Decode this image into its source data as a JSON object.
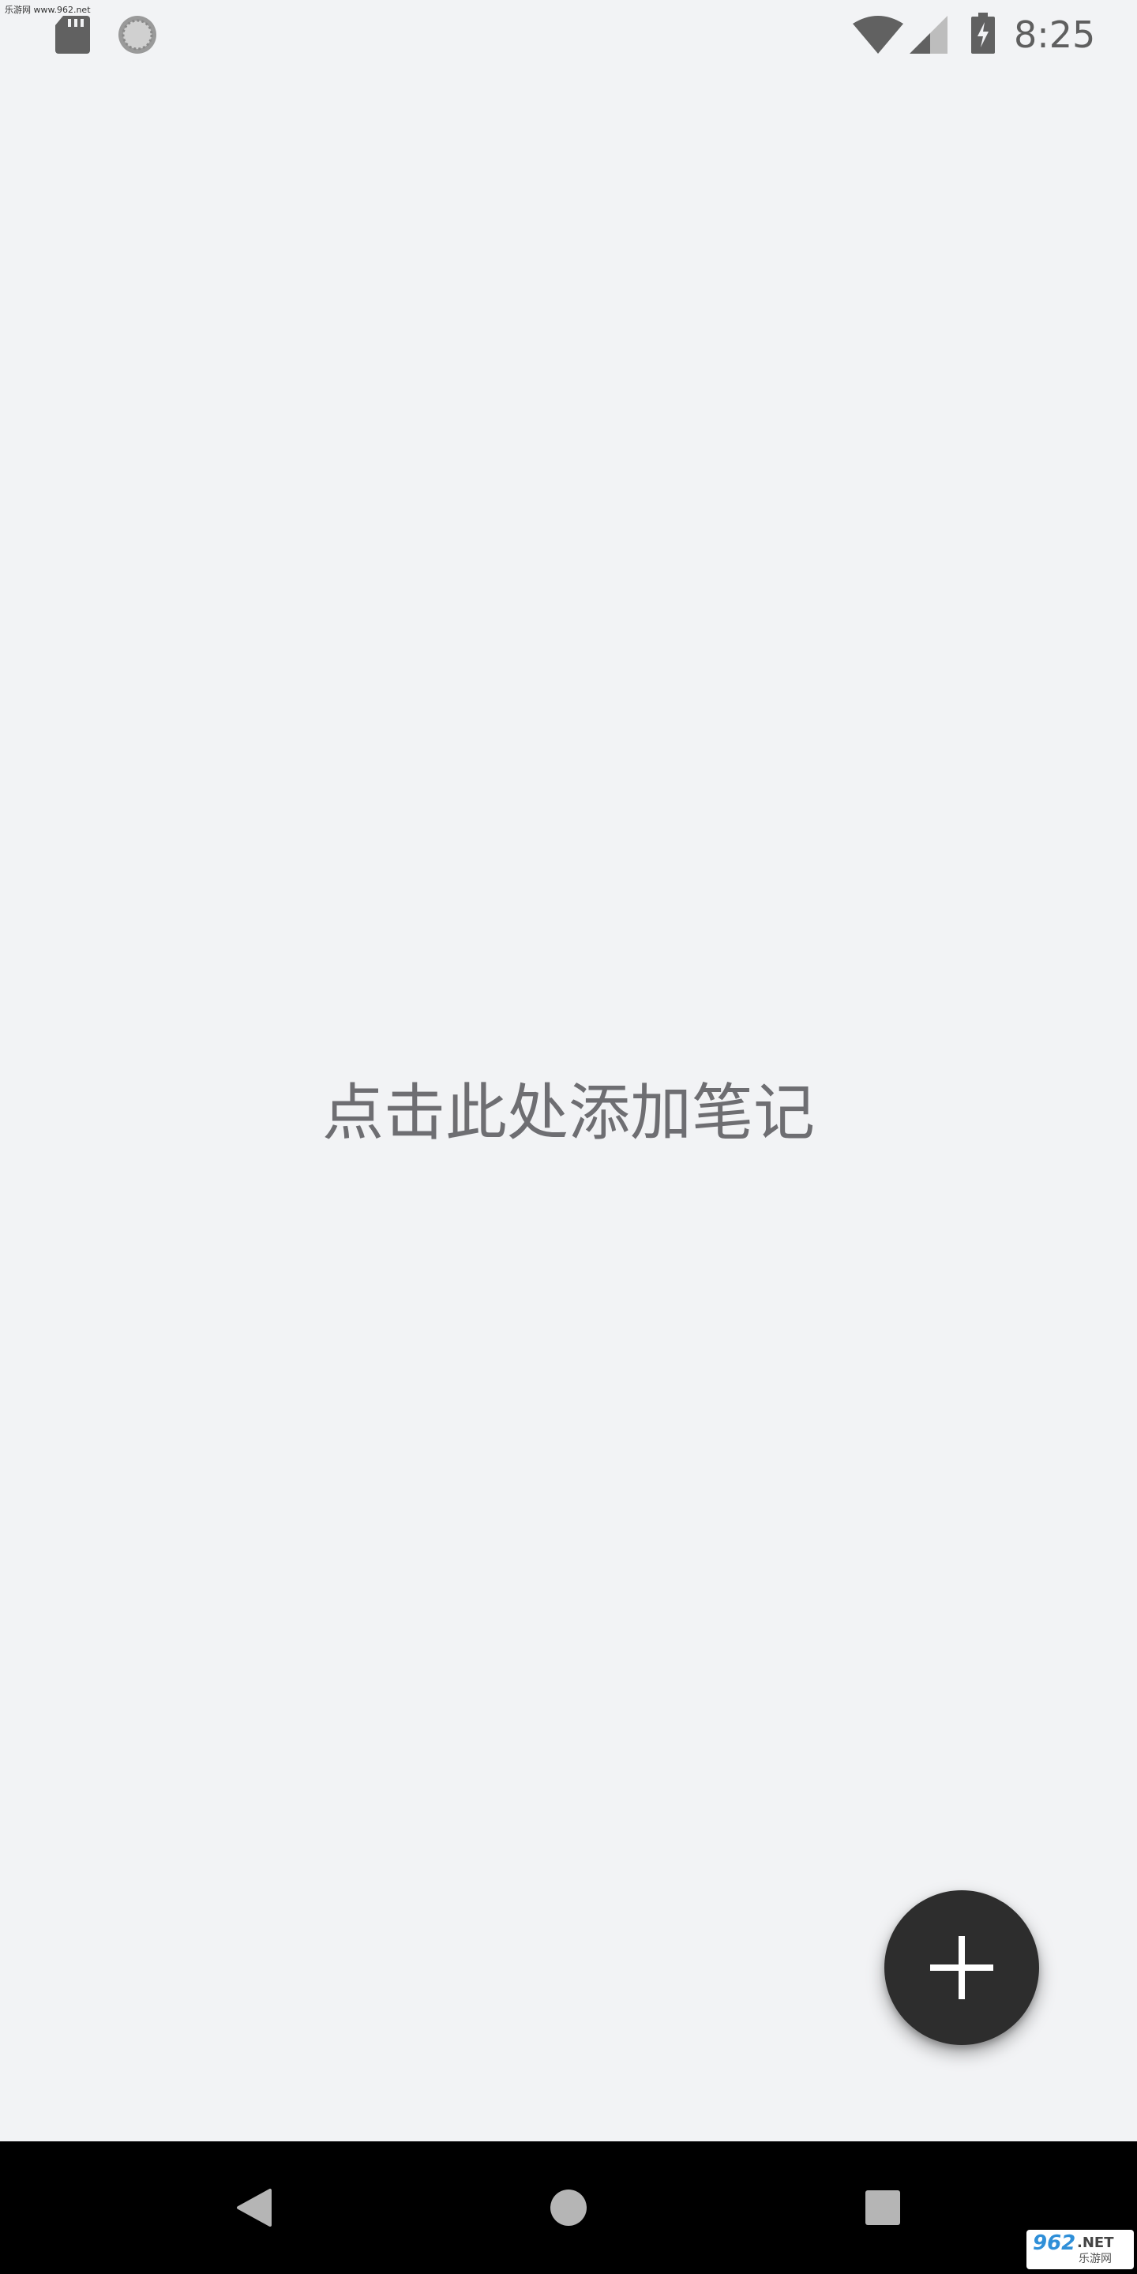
{
  "status_bar": {
    "watermark": "乐游网 www.962.net",
    "time": "8:25",
    "icons": [
      "sd-card-icon",
      "sync-icon",
      "wifi-icon",
      "cell-signal-icon",
      "battery-charging-icon"
    ]
  },
  "main": {
    "empty_hint": "点击此处添加笔记"
  },
  "fab": {
    "icon": "plus-icon"
  },
  "navigation_bar": {
    "buttons": [
      "back-icon",
      "home-icon",
      "recents-icon"
    ]
  },
  "corner_logo": {
    "number": "962",
    "net": ".NET",
    "chinese": "乐游网"
  },
  "colors": {
    "background": "#f2f3f5",
    "fab": "#2d2d2d",
    "hint_text": "#6e6e72",
    "nav_bar": "#000000"
  }
}
